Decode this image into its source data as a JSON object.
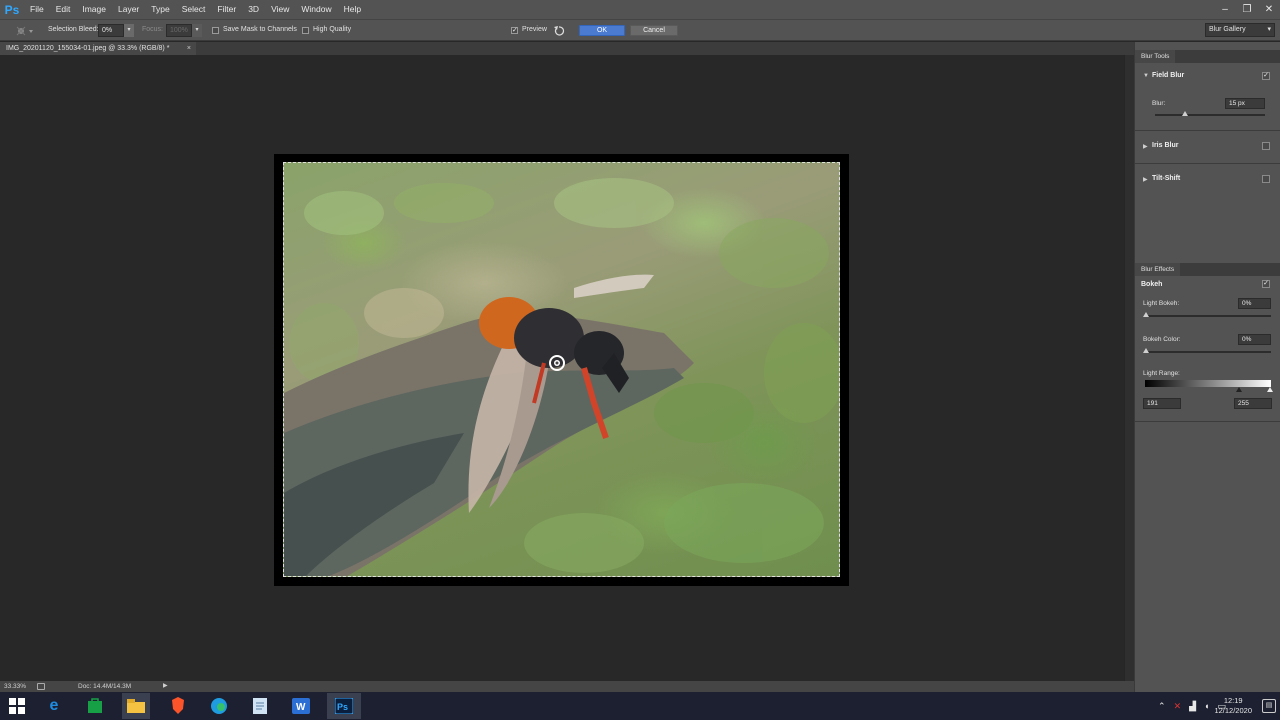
{
  "app": {
    "logo": "Ps",
    "colors": {
      "accent": "#31a8ff",
      "ok_button": "#4a7bd1"
    }
  },
  "menu": [
    "File",
    "Edit",
    "Image",
    "Layer",
    "Type",
    "Select",
    "Filter",
    "3D",
    "View",
    "Window",
    "Help"
  ],
  "window_controls": {
    "minimize": "–",
    "restore": "❐",
    "close": "✕"
  },
  "options_bar": {
    "tool_icon": "blur-pin-icon",
    "selection_bleed_label": "Selection Bleed:",
    "selection_bleed_value": "0%",
    "focus_label": "Focus:",
    "focus_value": "100%",
    "save_mask_label": "Save Mask to Channels",
    "high_quality_label": "High Quality",
    "preview_label": "Preview",
    "preview_checked": "✓",
    "ok_label": "OK",
    "cancel_label": "Cancel",
    "workspace": "Blur Gallery"
  },
  "document": {
    "tab_title": "IMG_20201120_155034-01.jpeg @ 33.3% (RGB/8) *",
    "close": "×"
  },
  "status": {
    "zoom": "33.33%",
    "doc_info": "Doc: 14.4M/14.3M"
  },
  "blur_tools": {
    "panel_title": "Blur Tools",
    "field_blur": {
      "label": "Field Blur",
      "checked": "✓",
      "blur_label": "Blur:",
      "blur_value": "15 px",
      "blur_fraction": 0.27
    },
    "iris_blur": {
      "label": "Iris Blur"
    },
    "tilt_shift": {
      "label": "Tilt-Shift"
    }
  },
  "blur_effects": {
    "panel_title": "Blur Effects",
    "bokeh_label": "Bokeh",
    "bokeh_checked": "✓",
    "light_bokeh_label": "Light Bokeh:",
    "light_bokeh_value": "0%",
    "bokeh_color_label": "Bokeh Color:",
    "bokeh_color_value": "0%",
    "light_range_label": "Light Range:",
    "light_range_min": "191",
    "light_range_max": "255"
  },
  "taskbar": {
    "apps": [
      "windows-start-icon",
      "internet-explorer-icon",
      "store-icon",
      "file-explorer-icon",
      "brave-icon",
      "edge-icon",
      "notepad-icon",
      "word-icon",
      "photoshop-icon"
    ],
    "time": "12:19",
    "date": "12/12/2020"
  }
}
